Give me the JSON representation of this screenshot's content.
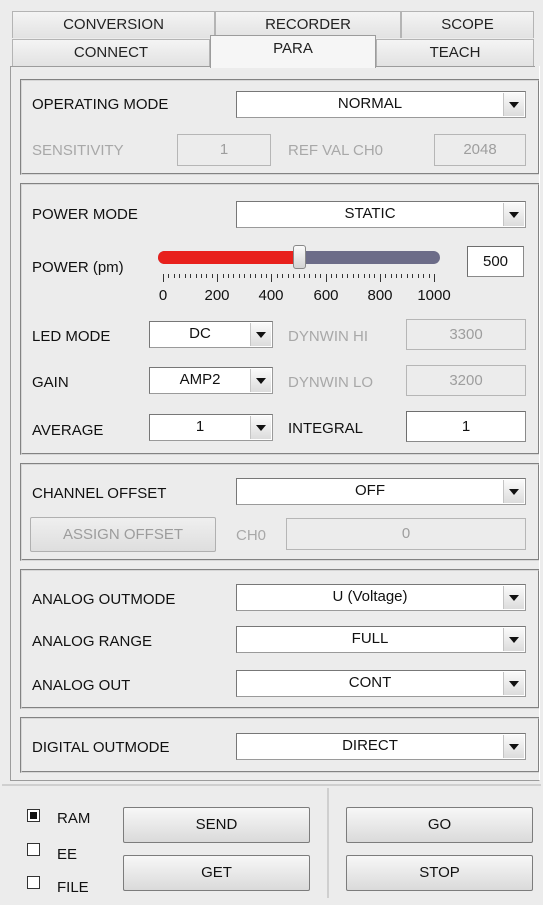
{
  "tabs": {
    "row1": [
      "CONVERSION",
      "RECORDER",
      "SCOPE"
    ],
    "row2": [
      "CONNECT",
      "PARA",
      "TEACH"
    ],
    "active": "PARA"
  },
  "operating": {
    "mode_label": "OPERATING MODE",
    "mode_value": "NORMAL",
    "sensitivity_label": "SENSITIVITY",
    "sensitivity_value": "1",
    "refval_label": "REF VAL CH0",
    "refval_value": "2048"
  },
  "power": {
    "mode_label": "POWER MODE",
    "mode_value": "STATIC",
    "power_label": "POWER (pm)",
    "power_value": "500",
    "slider": {
      "min": 0,
      "max": 1000,
      "value": 500,
      "ticks": [
        "0",
        "200",
        "400",
        "600",
        "800",
        "1000"
      ]
    },
    "led_mode_label": "LED MODE",
    "led_mode_value": "DC",
    "dynwin_hi_label": "DYNWIN HI",
    "dynwin_hi_value": "3300",
    "gain_label": "GAIN",
    "gain_value": "AMP2",
    "dynwin_lo_label": "DYNWIN LO",
    "dynwin_lo_value": "3200",
    "average_label": "AVERAGE",
    "average_value": "1",
    "integral_label": "INTEGRAL",
    "integral_value": "1"
  },
  "offset": {
    "channel_offset_label": "CHANNEL OFFSET",
    "channel_offset_value": "OFF",
    "assign_button": "ASSIGN OFFSET",
    "ch0_label": "CH0",
    "ch0_value": "0"
  },
  "analog": {
    "outmode_label": "ANALOG OUTMODE",
    "outmode_value": "U (Voltage)",
    "range_label": "ANALOG RANGE",
    "range_value": "FULL",
    "out_label": "ANALOG OUT",
    "out_value": "CONT"
  },
  "digital": {
    "outmode_label": "DIGITAL OUTMODE",
    "outmode_value": "DIRECT"
  },
  "bottom": {
    "ram_label": "RAM",
    "ram_checked": true,
    "ee_label": "EE",
    "ee_checked": false,
    "file_label": "FILE",
    "file_checked": false,
    "send_button": "SEND",
    "get_button": "GET",
    "go_button": "GO",
    "stop_button": "STOP"
  },
  "colors": {
    "slider_fill": "#e8201c",
    "slider_track": "#6c6c88",
    "background": "#ececec"
  }
}
